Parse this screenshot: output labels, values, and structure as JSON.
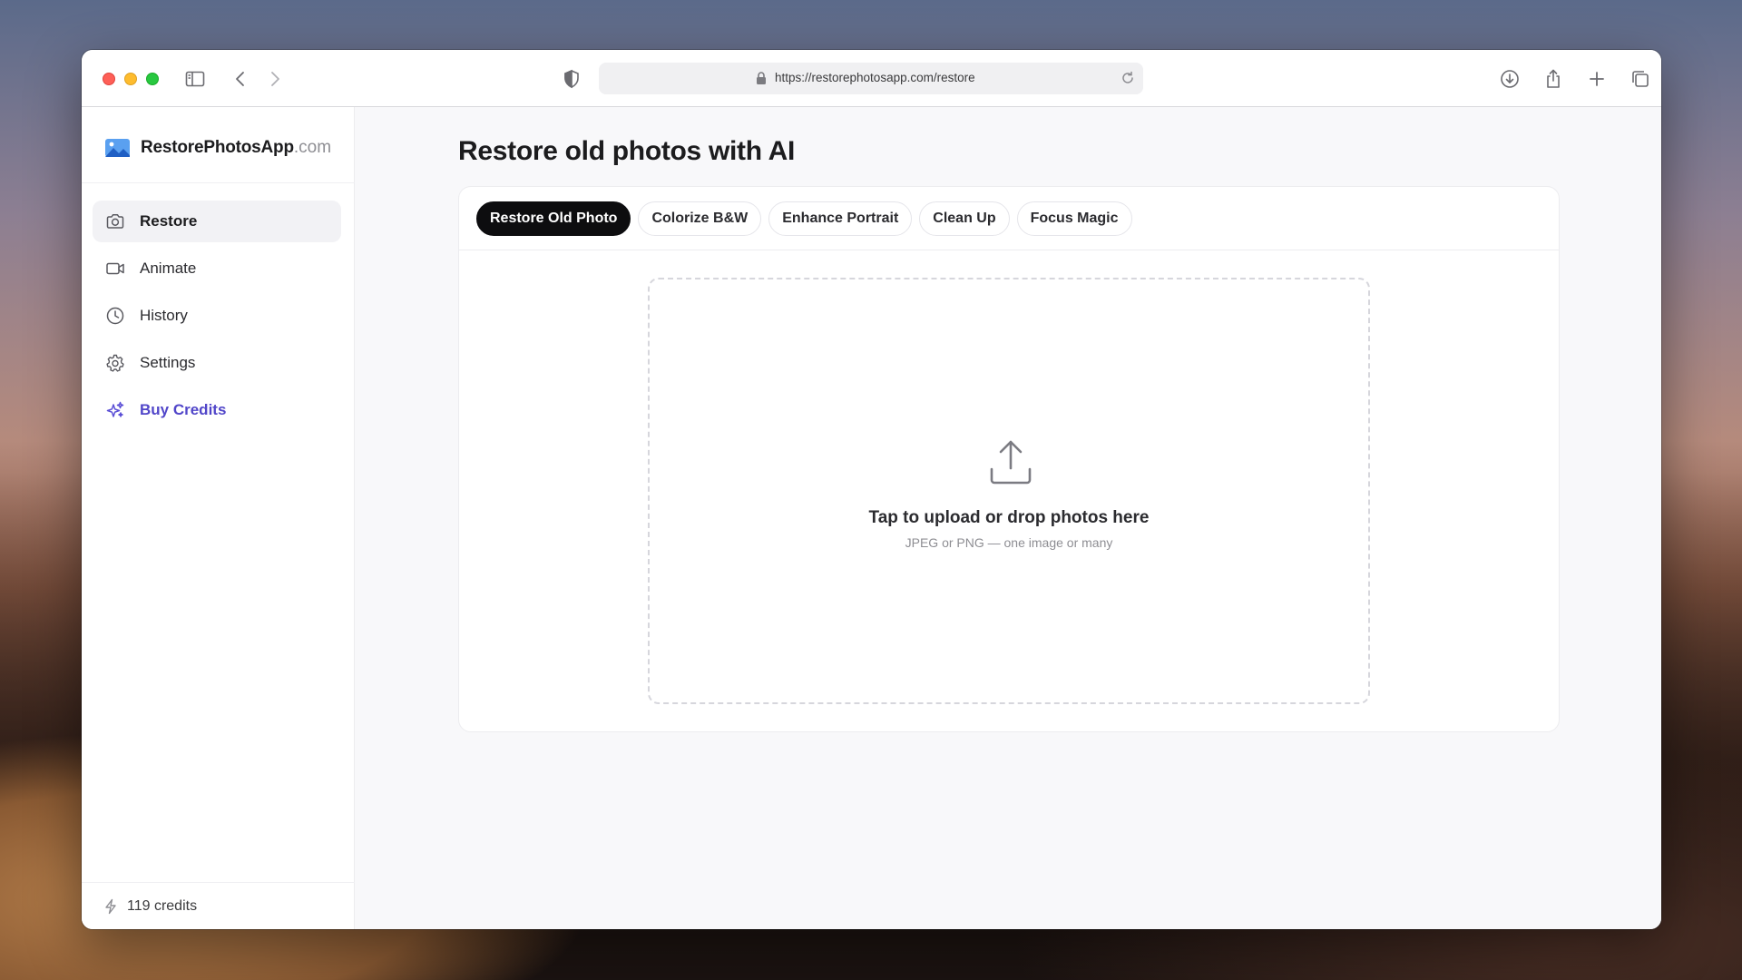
{
  "browser": {
    "url": "https://restorephotosapp.com/restore"
  },
  "brand": {
    "name": "RestorePhotosApp",
    "tld": ".com"
  },
  "sidebar": {
    "items": [
      {
        "label": "Restore",
        "icon": "camera-icon",
        "active": true
      },
      {
        "label": "Animate",
        "icon": "video-camera-icon",
        "active": false
      },
      {
        "label": "History",
        "icon": "clock-icon",
        "active": false
      },
      {
        "label": "Settings",
        "icon": "gear-icon",
        "active": false
      },
      {
        "label": "Buy Credits",
        "icon": "sparkles-icon",
        "active": false
      }
    ],
    "footer": {
      "credits_label": "119 credits",
      "icon": "bolt-icon"
    }
  },
  "main": {
    "title": "Restore old photos with AI",
    "tabs": [
      {
        "label": "Restore Old Photo",
        "active": true
      },
      {
        "label": "Colorize B&W",
        "active": false
      },
      {
        "label": "Enhance Portrait",
        "active": false
      },
      {
        "label": "Clean Up",
        "active": false
      },
      {
        "label": "Focus Magic",
        "active": false
      }
    ],
    "dropzone": {
      "title": "Tap to upload or drop photos here",
      "subtitle": "JPEG or PNG — one image or many",
      "icon": "upload-icon"
    }
  },
  "colors": {
    "accent": "#5146c9",
    "active_tab": "#0d0d0f",
    "active_nav_bg": "#f2f2f5"
  }
}
